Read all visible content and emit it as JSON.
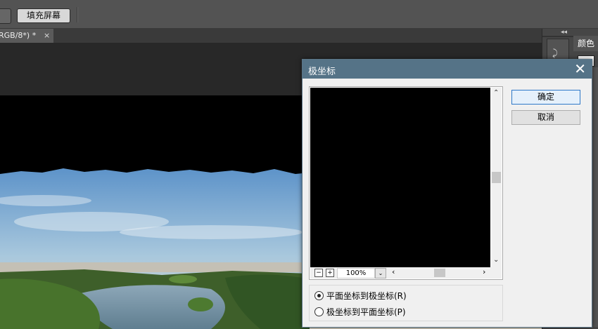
{
  "options_bar": {
    "fill_screen_label": "填充屏幕"
  },
  "tab": {
    "title": "RGB/8*) *",
    "close": "×"
  },
  "right_panel": {
    "collapse": "◂◂",
    "color_tab_label": "颜色"
  },
  "dialog": {
    "title": "极坐标",
    "close_glyph": "✕",
    "ok_label": "确定",
    "cancel_label": "取消",
    "zoom_value": "100%",
    "zoom_minus": "−",
    "zoom_plus": "+",
    "options": [
      {
        "label": "平面坐标到极坐标(R)",
        "selected": true
      },
      {
        "label": "极坐标到平面坐标(P)",
        "selected": false
      }
    ]
  },
  "colors": {
    "dialog_title_bg": "#557387",
    "ok_border": "#2e78c8"
  }
}
